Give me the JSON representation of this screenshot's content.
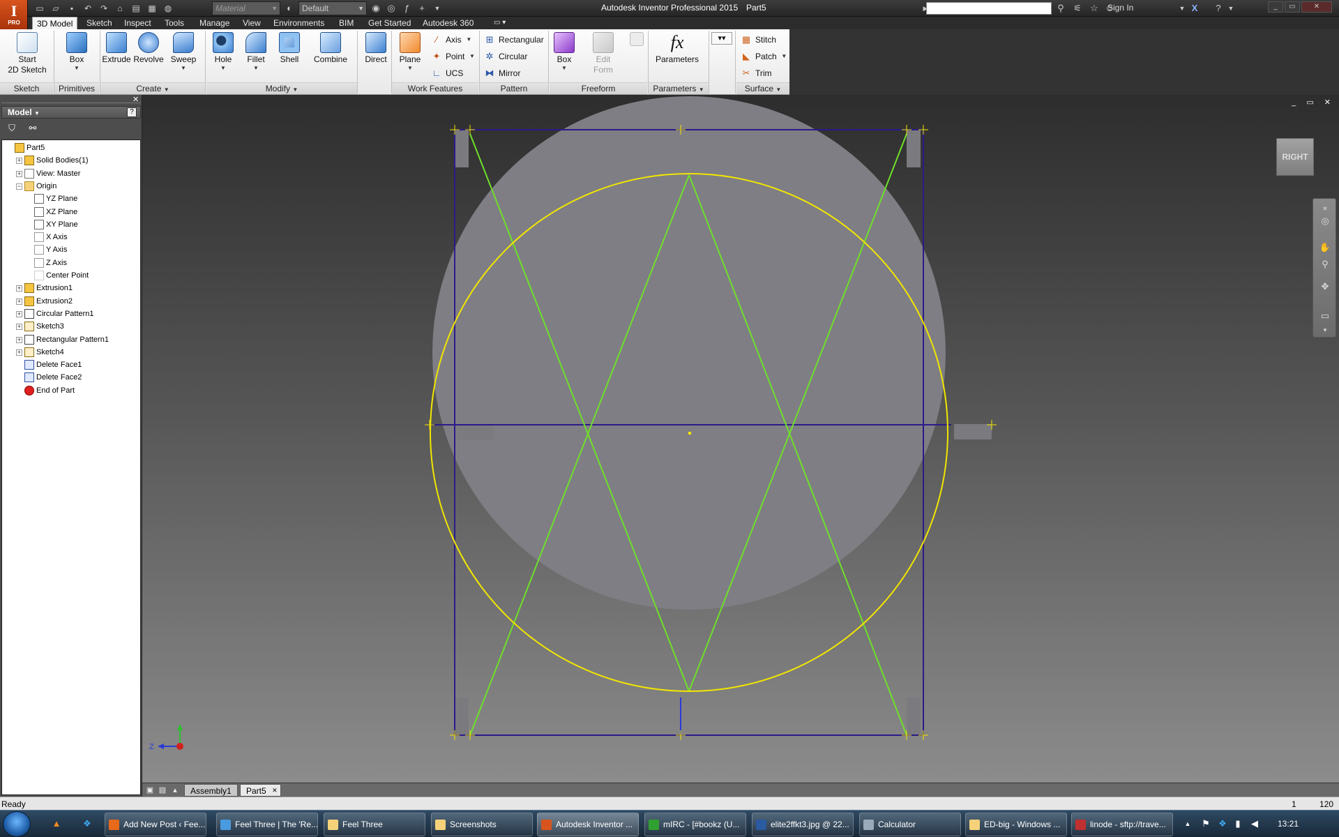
{
  "titlebar": {
    "app_title": "Autodesk Inventor Professional 2015",
    "document": "Part5",
    "material_combo": "Material",
    "appearance_combo": "Default",
    "sign_in": "Sign In",
    "app_badge": "PRO"
  },
  "tabs": [
    "3D Model",
    "Sketch",
    "Inspect",
    "Tools",
    "Manage",
    "View",
    "Environments",
    "BIM",
    "Get Started",
    "Autodesk 360"
  ],
  "ribbon": {
    "start_sketch": "Start\n2D Sketch",
    "create": [
      "Box",
      "Extrude",
      "Revolve",
      "Sweep"
    ],
    "modify": [
      "Hole",
      "Fillet",
      "Shell",
      "Combine"
    ],
    "direct": "Direct",
    "plane": "Plane",
    "work_small": [
      "Axis",
      "Point",
      "UCS"
    ],
    "pattern_small": [
      "Rectangular",
      "Circular",
      "Mirror"
    ],
    "freeform": [
      "Box",
      "Edit\nForm"
    ],
    "parameters": "Parameters",
    "surface_small": [
      "Stitch",
      "Patch",
      "Trim"
    ],
    "panel_titles": [
      "Sketch",
      "Primitives",
      "Create",
      "Modify",
      "Work Features",
      "Pattern",
      "Freeform",
      "Parameters",
      "Surface"
    ],
    "fx": "fx"
  },
  "browser": {
    "title": "Model",
    "help": "?",
    "tree": [
      {
        "label": "Part5",
        "icon": "part-icon"
      },
      {
        "label": "Solid Bodies(1)",
        "icon": "solid-bodies-icon"
      },
      {
        "label": "View: Master",
        "icon": "view-icon"
      },
      {
        "label": "Origin",
        "icon": "folder-icon"
      },
      {
        "label": "YZ Plane",
        "icon": "plane-icon"
      },
      {
        "label": "XZ Plane",
        "icon": "plane-icon"
      },
      {
        "label": "XY Plane",
        "icon": "plane-icon"
      },
      {
        "label": "X Axis",
        "icon": "axis-icon"
      },
      {
        "label": "Y Axis",
        "icon": "axis-icon"
      },
      {
        "label": "Z Axis",
        "icon": "axis-icon"
      },
      {
        "label": "Center Point",
        "icon": "point-icon"
      },
      {
        "label": "Extrusion1",
        "icon": "extrusion-icon"
      },
      {
        "label": "Extrusion2",
        "icon": "extrusion-icon"
      },
      {
        "label": "Circular Pattern1",
        "icon": "circular-pattern-icon"
      },
      {
        "label": "Sketch3",
        "icon": "sketch-icon"
      },
      {
        "label": "Rectangular Pattern1",
        "icon": "rectangular-pattern-icon"
      },
      {
        "label": "Sketch4",
        "icon": "sketch-icon"
      },
      {
        "label": "Delete Face1",
        "icon": "delete-face-icon"
      },
      {
        "label": "Delete Face2",
        "icon": "delete-face-icon"
      },
      {
        "label": "End of Part",
        "icon": "end-of-part-icon"
      }
    ]
  },
  "viewport": {
    "viewcube_face": "RIGHT",
    "triad_label": "Z"
  },
  "doc_tabs": [
    "Assembly1",
    "Part5"
  ],
  "status": {
    "text": "Ready",
    "num1": "1",
    "num2": "120"
  },
  "taskbar": {
    "items": [
      "Add New Post ‹ Fee...",
      "Feel Three | The 'Re...",
      "Feel Three",
      "Screenshots",
      "Autodesk Inventor ...",
      "mIRC - [#bookz (U...",
      "elite2ffkt3.jpg @ 22...",
      "Calculator",
      "ED-big - Windows ...",
      "linode - sftp://trave..."
    ],
    "clock": "13:21"
  },
  "colors": {
    "sketch_circle": "#f2e600",
    "construction_lines": "#6fe02a",
    "profile_lines": "#2a1b8a",
    "viewport_top": "#2d2d2d",
    "viewport_bottom": "#8c8c8c"
  }
}
